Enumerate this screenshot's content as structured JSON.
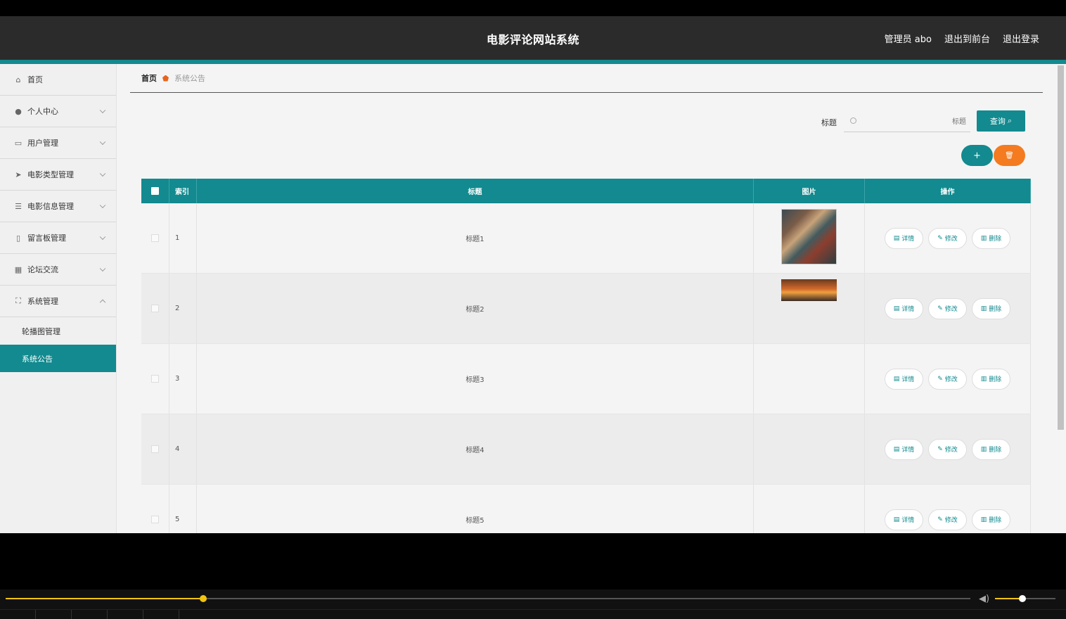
{
  "header": {
    "site_title": "电影评论网站系统",
    "admin_label": "管理员 abo",
    "back_to_front": "退出到前台",
    "logout": "退出登录"
  },
  "sidebar": {
    "items": [
      {
        "label": "首页",
        "icon": "home-icon"
      },
      {
        "label": "个人中心",
        "icon": "user-icon"
      },
      {
        "label": "用户管理",
        "icon": "chat-icon"
      },
      {
        "label": "电影类型管理",
        "icon": "send-icon"
      },
      {
        "label": "电影信息管理",
        "icon": "list-icon"
      },
      {
        "label": "留言板管理",
        "icon": "phone-icon"
      },
      {
        "label": "论坛交流",
        "icon": "grid-icon"
      },
      {
        "label": "系统管理",
        "icon": "fullscreen-icon"
      }
    ],
    "sub_items": [
      {
        "label": "轮播图管理",
        "active": false
      },
      {
        "label": "系统公告",
        "active": true
      }
    ]
  },
  "breadcrumb": {
    "home": "首页",
    "current": "系统公告"
  },
  "search": {
    "label": "标题",
    "placeholder": "标题",
    "query_button": "查询"
  },
  "table": {
    "headers": {
      "index": "索引",
      "title": "标题",
      "image": "图片",
      "actions": "操作"
    },
    "rows": [
      {
        "index": "1",
        "title": "标题1"
      },
      {
        "index": "2",
        "title": "标题2"
      },
      {
        "index": "3",
        "title": "标题3"
      },
      {
        "index": "4",
        "title": "标题4"
      },
      {
        "index": "5",
        "title": "标题5"
      }
    ],
    "actions": {
      "detail": "详情",
      "edit": "修改",
      "delete": "删除"
    }
  },
  "player": {
    "progress": 0.205,
    "volume": 0.45
  },
  "colors": {
    "accent": "#128a8f",
    "danger": "#f47b20",
    "topbar": "#2b2b2b"
  }
}
